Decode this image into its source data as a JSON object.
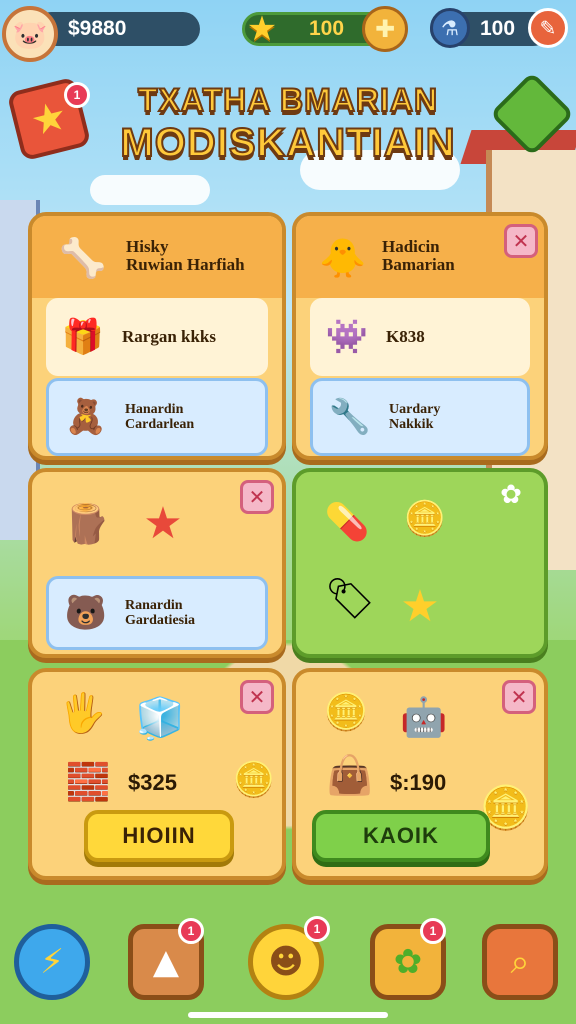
{
  "currency": {
    "coins": "$9880",
    "stars": "100",
    "gems": "100"
  },
  "title": {
    "line1": "TXATHA BMARIAN",
    "line2": "MODISKANTIAIN"
  },
  "badges": {
    "star_tile": "1",
    "nav_2": "1",
    "nav_3": "1",
    "nav_5": "1"
  },
  "cards": {
    "card1": {
      "header": "Hisky\nRuwian Harfiah",
      "item1": "Rargan kkks",
      "item2": "Hanardin\nCardarlean"
    },
    "card2": {
      "header": "Hadicin\nBamarian",
      "item1": "K838",
      "item2": "Uardary\nNakkik"
    },
    "card3": {
      "item1": "Ranardin\nGardatiesia"
    },
    "card5": {
      "price": "$325",
      "button": "HIOIIN"
    },
    "card6": {
      "price": "$:190",
      "button": "KAOIK"
    }
  },
  "colors": {
    "card": "#fcd27a",
    "card_green": "#9ed65a",
    "accent_yellow": "#ffd83a",
    "accent_green": "#7fd04a",
    "title": "#ffc93a"
  }
}
